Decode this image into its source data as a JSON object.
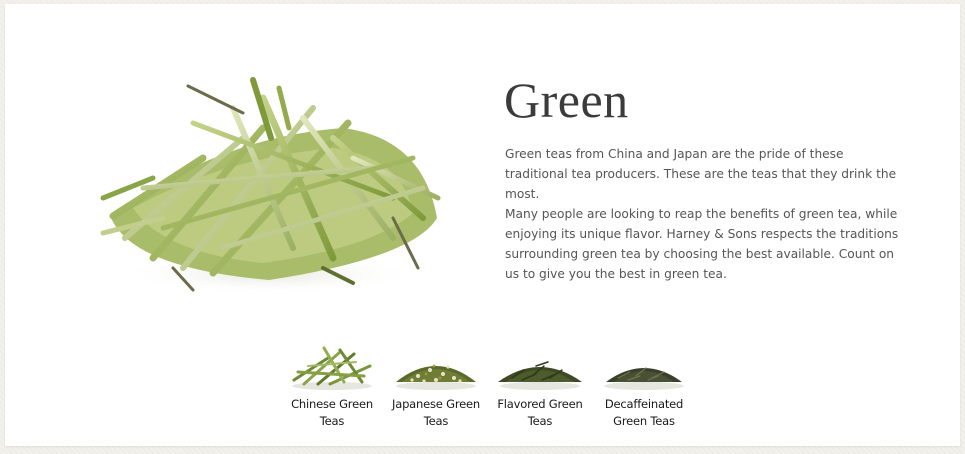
{
  "category": {
    "title": "Green",
    "hero_image_icon": "loose-green-tea-leaves-icon",
    "description_paragraphs": [
      "Green teas from China and Japan are the pride of these traditional tea producers. These are the teas that they drink the most.",
      "Many people are looking to reap the benefits of green tea, while enjoying its unique flavor. Harney & Sons respects the traditions surrounding green tea by choosing the best available. Count on us to give you the best in green tea."
    ]
  },
  "subcategories": [
    {
      "label": "Chinese Green Teas",
      "icon": "chinese-green-tea-leaves-icon"
    },
    {
      "label": "Japanese Green Teas",
      "icon": "japanese-green-tea-blend-icon"
    },
    {
      "label": "Flavored Green Teas",
      "icon": "flavored-green-tea-leaves-icon"
    },
    {
      "label": "Decaffeinated Green Teas",
      "icon": "decaffeinated-green-tea-leaves-icon"
    }
  ],
  "colors": {
    "background": "#efeee9",
    "card": "#ffffff",
    "title_text": "#3b3b3b",
    "body_text": "#555555",
    "label_text": "#1a1a1a",
    "leaf_green": "#9fb45a",
    "leaf_dark": "#4a5a2a"
  }
}
